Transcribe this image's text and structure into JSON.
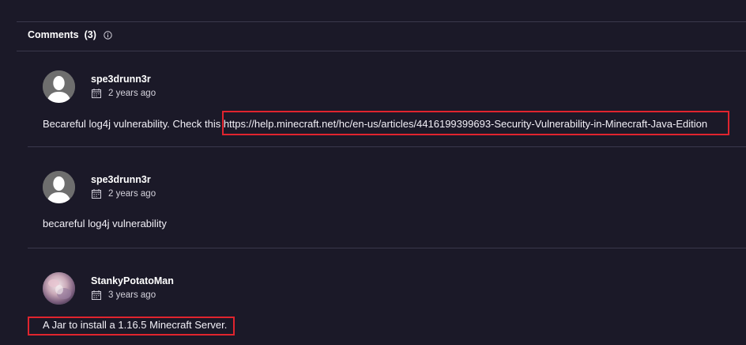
{
  "comments_section": {
    "title": "Comments",
    "count": "(3)",
    "info_icon": "info-icon"
  },
  "comments": [
    {
      "author": "spe3drunn3r",
      "time": "2 years ago",
      "avatar": "default-user-avatar",
      "text_prefix": "Becareful log4j vulnerability. Check this ",
      "link": "https://help.minecraft.net/hc/en-us/articles/4416199399693-Security-Vulnerability-in-Minecraft-Java-Edition"
    },
    {
      "author": "spe3drunn3r",
      "time": "2 years ago",
      "avatar": "default-user-avatar",
      "text": "becareful log4j vulnerability"
    },
    {
      "author": "StankyPotatoMan",
      "time": "3 years ago",
      "avatar": "custom-user-avatar",
      "text": "A Jar to install a 1.16.5 Minecraft Server."
    }
  ],
  "colors": {
    "background": "#1b1928",
    "highlight": "#e0242e",
    "divider": "#3a384c"
  }
}
